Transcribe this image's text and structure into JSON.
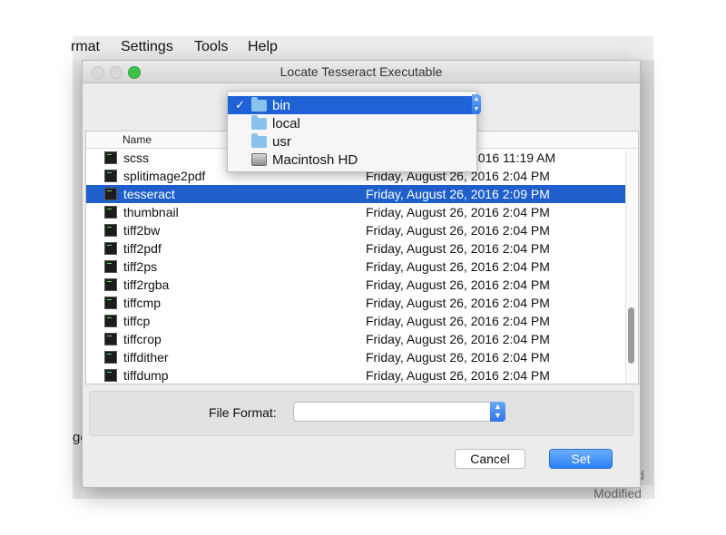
{
  "menubar": {
    "items": [
      "rmat",
      "Settings",
      "Tools",
      "Help"
    ]
  },
  "background": {
    "left_fragment": "ge",
    "right_fragment_1": "d",
    "right_fragment_2": "Modified"
  },
  "dialog": {
    "title": "Locate Tesseract Executable",
    "list_header_name": "Name",
    "rows": [
      {
        "name": "scss",
        "date": "2016 11:19 AM"
      },
      {
        "name": "splitimage2pdf",
        "date": "Friday, August 26, 2016 2:04 PM"
      },
      {
        "name": "tesseract",
        "date": "Friday, August 26, 2016 2:09 PM"
      },
      {
        "name": "thumbnail",
        "date": "Friday, August 26, 2016 2:04 PM"
      },
      {
        "name": "tiff2bw",
        "date": "Friday, August 26, 2016 2:04 PM"
      },
      {
        "name": "tiff2pdf",
        "date": "Friday, August 26, 2016 2:04 PM"
      },
      {
        "name": "tiff2ps",
        "date": "Friday, August 26, 2016 2:04 PM"
      },
      {
        "name": "tiff2rgba",
        "date": "Friday, August 26, 2016 2:04 PM"
      },
      {
        "name": "tiffcmp",
        "date": "Friday, August 26, 2016 2:04 PM"
      },
      {
        "name": "tiffcp",
        "date": "Friday, August 26, 2016 2:04 PM"
      },
      {
        "name": "tiffcrop",
        "date": "Friday, August 26, 2016 2:04 PM"
      },
      {
        "name": "tiffdither",
        "date": "Friday, August 26, 2016 2:04 PM"
      },
      {
        "name": "tiffdump",
        "date": "Friday, August 26, 2016 2:04 PM"
      }
    ],
    "file_format_label": "File Format:",
    "file_format_value": "",
    "cancel_label": "Cancel",
    "set_label": "Set"
  },
  "location_popup": {
    "checkmark": "✓",
    "items": [
      {
        "label": "bin",
        "icon": "folder-icon",
        "selected": true
      },
      {
        "label": "local",
        "icon": "folder-icon",
        "selected": false
      },
      {
        "label": "usr",
        "icon": "folder-icon",
        "selected": false
      },
      {
        "label": "Macintosh HD",
        "icon": "hard-drive-icon",
        "selected": false
      }
    ]
  },
  "colors": {
    "selection": "#1e5fcc",
    "accent_button": "#2a7ff4",
    "folder": "#8ac2ee"
  }
}
